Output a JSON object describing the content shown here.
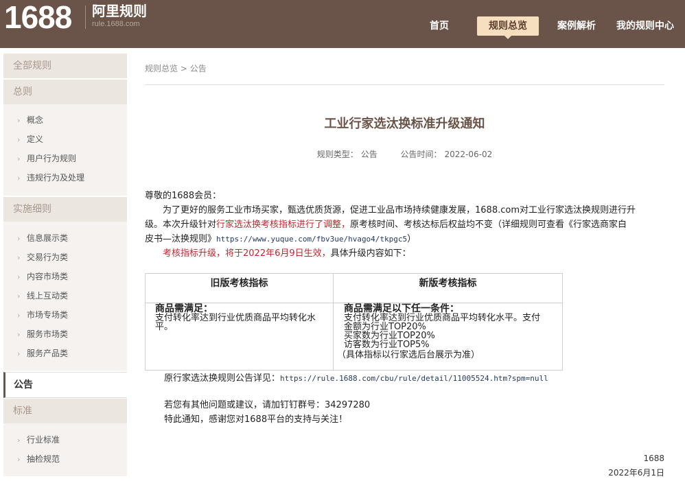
{
  "header": {
    "logo": "1688",
    "site_title": "阿里规则",
    "site_url": "rule.1688.com",
    "nav": [
      {
        "label": "首页"
      },
      {
        "label": "规则总览"
      },
      {
        "label": "案例解析"
      },
      {
        "label": "我的规则中心"
      }
    ]
  },
  "sidebar": {
    "all_rules": "全部规则",
    "general": "总则",
    "general_items": [
      "概念",
      "定义",
      "用户行为规则",
      "违规行为及处理"
    ],
    "details": "实施细则",
    "details_items": [
      "信息展示类",
      "交易行为类",
      "内容市场类",
      "线上互动类",
      "市场专场类",
      "服务市场类",
      "服务产品类"
    ],
    "announcement": "公告",
    "standards": "标准",
    "standards_items": [
      "行业标准",
      "抽检规范"
    ]
  },
  "breadcrumb": {
    "root": "规则总览",
    "sep": ">",
    "current": "公告"
  },
  "article": {
    "title": "工业行家选汰换标准升级通知",
    "type_label": "规则类型：",
    "type_value": "公告",
    "time_label": "公告时间：",
    "time_value": "2022-06-02",
    "greeting": "尊敬的1688会员：",
    "p1_line1": "为了更好的服务工业市场买家，甄选优质货源，促进工业品市场持续健康发展，1688.com对工业行家选汰换规则进行升",
    "p1_line2_a": "级。本次升级针对",
    "p1_line2_red": "行家选汰换考核指标进行了调整，",
    "p1_line2_b": "原考核时间、考核达标后权益均不变（详细规则可查看《行家选商家白",
    "p1_line3_a": "皮书—汰换规则》",
    "p1_line3_link": "https://www.yuque.com/fbv3ue/hvago4/tkpgc5",
    "p1_line3_b": "）",
    "p2_red": "考核指标升级，将于2022年6月9日生效，",
    "p2_rest": "具体升级内容如下：",
    "table": {
      "head_old": "旧版考核指标",
      "head_new": "新版考核指标",
      "old_title": "商品需满足：",
      "old_line1": "支付转化率达到行业优质商品平均转化水",
      "old_line2": "平。",
      "new_title": "商品需满足以下任一条件：",
      "new_line1": "支付转化率达到行业优质商品平均转化水平。支付",
      "new_line2": "金额为行业TOP20%",
      "new_line3": "买家数为行业TOP20%",
      "new_line4": "访客数为行业TOP5%",
      "new_note": "（具体指标以行家选后台展示为准）"
    },
    "orig_label": "原行家选汰换规则公告详见：",
    "orig_link": "https://rule.1688.com/cbu/rule/detail/11005524.htm?spm=null",
    "contact": "若您有其他问题或建议，请加钉钉群号：34297280",
    "thanks": "特此通知，感谢您对1688平台的支持与关注！",
    "sign_org": "1688",
    "sign_date": "2022年6月1日"
  }
}
